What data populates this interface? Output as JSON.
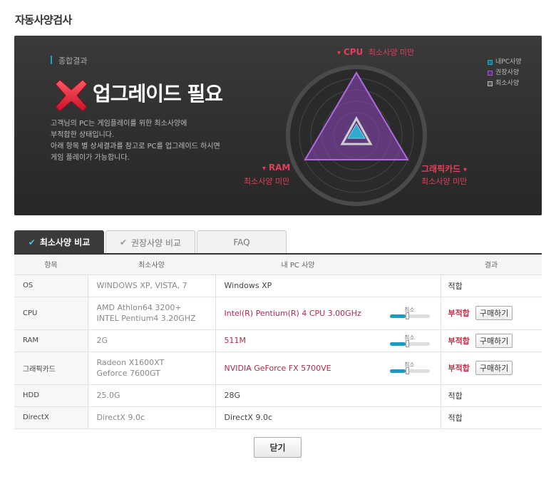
{
  "page_title": "자동사양검사",
  "summary": {
    "label": "종합결과",
    "headline": "업그레이드 필요",
    "description": [
      "고객님의 PC는 게임플레이를 위한 최소사양에",
      "부적합한 상태입니다.",
      "아래 항목 별 상세결과를 참고로 PC를 업그레이드 하시면",
      "게임 플레이가 가능합니다."
    ],
    "axes": {
      "cpu": {
        "name": "CPU",
        "status": "최소사양 미만"
      },
      "ram": {
        "name": "RAM",
        "status": "최소사양 미만"
      },
      "gpu": {
        "name": "그래픽카드",
        "status": "최소사양 미만"
      }
    },
    "legend": [
      {
        "label": "내PC사양",
        "color": "#1ea7c7"
      },
      {
        "label": "권장사양",
        "color": "#a05ad0"
      },
      {
        "label": "최소사양",
        "color": "#bbbbbb"
      }
    ]
  },
  "tabs": [
    {
      "label": "최소사양 비교"
    },
    {
      "label": "권장사양 비교"
    },
    {
      "label": "FAQ"
    }
  ],
  "table": {
    "headers": {
      "item": "항목",
      "min": "최소사양",
      "my": "내 PC 사양",
      "result": "결과"
    },
    "bar_caption": "최소",
    "buy_label": "구매하기",
    "rows": [
      {
        "item": "OS",
        "min1": "WINDOWS XP, VISTA, 7",
        "min2": "",
        "my": "Windows XP",
        "result": "적합"
      },
      {
        "item": "CPU",
        "min1": "AMD Athlon64 3200+",
        "min2": "INTEL Pentium4 3.20GHZ",
        "my": "Intel(R) Pentium(R) 4 CPU 3.00GHz",
        "result": "부적합"
      },
      {
        "item": "RAM",
        "min1": "2G",
        "min2": "",
        "my": "511M",
        "result": "부적합"
      },
      {
        "item": "그래픽카드",
        "min1": "Radeon X1600XT",
        "min2": "Geforce 7600GT",
        "my": "NVIDIA GeForce FX 5700VE",
        "result": "부적합"
      },
      {
        "item": "HDD",
        "min1": "25.0G",
        "min2": "",
        "my": "28G",
        "result": "적합"
      },
      {
        "item": "DirectX",
        "min1": "DirectX 9.0c",
        "min2": "",
        "my": "DirectX 9.0c",
        "result": "적합"
      }
    ]
  },
  "close_label": "닫기"
}
